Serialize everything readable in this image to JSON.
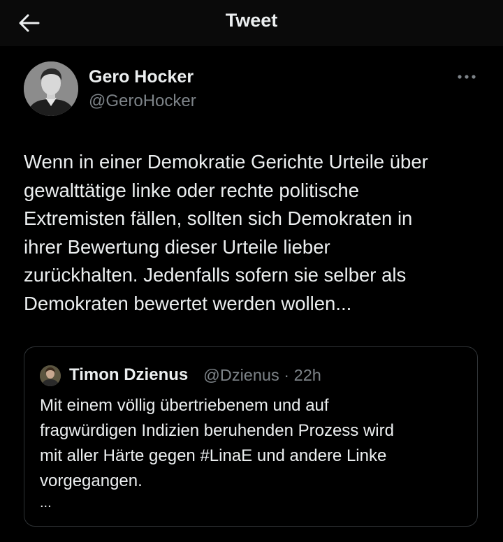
{
  "header": {
    "title": "Tweet",
    "back_icon": "arrow-left-icon"
  },
  "tweet": {
    "author_name": "Gero Hocker",
    "author_handle": "@GeroHocker",
    "more_icon": "more-horizontal-icon",
    "text": "Wenn in einer Demokratie Gerichte Urteile über\ngewalttätige linke oder rechte politische\nExtremisten fällen, sollten sich Demokraten in\nihrer Bewertung dieser Urteile lieber\nzurückhalten. Jedenfalls sofern sie selber als\nDemokraten bewertet werden wollen..."
  },
  "quoted_tweet": {
    "author_name": "Timon Dzienus",
    "author_handle": "@Dzienus",
    "separator": "·",
    "timestamp": "22h",
    "text": "Mit einem völlig übertriebenem und auf\nfragwürdigen Indizien beruhenden Prozess wird\nmit aller Härte gegen #LinaE und andere Linke\nvorgegangen.",
    "truncation": "..."
  },
  "colors": {
    "background": "#000000",
    "header_background": "#0a0a0a",
    "primary_text": "#eceff0",
    "secondary_text": "#7d8388",
    "border": "#2f3336"
  }
}
